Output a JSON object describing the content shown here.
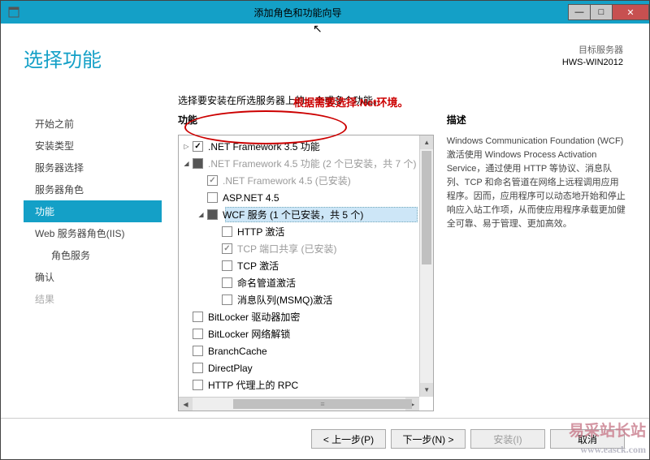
{
  "titlebar": {
    "title": "添加角色和功能向导"
  },
  "page_title": "选择功能",
  "server_info": {
    "label": "目标服务器",
    "name": "HWS-WIN2012"
  },
  "instruction": "选择要安装在所选服务器上的一个或多个功能。",
  "sidebar": {
    "items": [
      {
        "label": "开始之前"
      },
      {
        "label": "安装类型"
      },
      {
        "label": "服务器选择"
      },
      {
        "label": "服务器角色"
      },
      {
        "label": "功能"
      },
      {
        "label": "Web 服务器角色(IIS)"
      },
      {
        "label": "角色服务"
      },
      {
        "label": "确认"
      },
      {
        "label": "结果"
      }
    ]
  },
  "columns": {
    "func": "功能",
    "desc": "描述"
  },
  "annotation": "根据需要选择.Net环境。",
  "tree": {
    "items": [
      {
        "lv": 0,
        "exp": "▷",
        "chk": "checked",
        "label": ".NET Framework 3.5 功能"
      },
      {
        "lv": 0,
        "exp": "◢",
        "chk": "partial",
        "label": ".NET Framework 4.5 功能 (2 个已安装，共 7 个)",
        "dis": true
      },
      {
        "lv": 1,
        "exp": "",
        "chk": "checked dis",
        "label": ".NET Framework 4.5 (已安装)",
        "dis": true
      },
      {
        "lv": 1,
        "exp": "",
        "chk": "",
        "label": "ASP.NET 4.5"
      },
      {
        "lv": 1,
        "exp": "◢",
        "chk": "partial",
        "label": "WCF 服务 (1 个已安装，共 5 个)",
        "sel": true
      },
      {
        "lv": 2,
        "exp": "",
        "chk": "",
        "label": "HTTP 激活"
      },
      {
        "lv": 2,
        "exp": "",
        "chk": "checked dis",
        "label": "TCP 端口共享 (已安装)",
        "dis": true
      },
      {
        "lv": 2,
        "exp": "",
        "chk": "",
        "label": "TCP 激活"
      },
      {
        "lv": 2,
        "exp": "",
        "chk": "",
        "label": "命名管道激活"
      },
      {
        "lv": 2,
        "exp": "",
        "chk": "",
        "label": "消息队列(MSMQ)激活"
      },
      {
        "lv": 0,
        "exp": "",
        "chk": "",
        "label": "BitLocker 驱动器加密"
      },
      {
        "lv": 0,
        "exp": "",
        "chk": "",
        "label": "BitLocker 网络解锁"
      },
      {
        "lv": 0,
        "exp": "",
        "chk": "",
        "label": "BranchCache"
      },
      {
        "lv": 0,
        "exp": "",
        "chk": "",
        "label": "DirectPlay"
      },
      {
        "lv": 0,
        "exp": "",
        "chk": "",
        "label": "HTTP 代理上的 RPC"
      }
    ]
  },
  "description": "Windows Communication Foundation (WCF) 激活使用 Windows Process Activation Service，通过使用 HTTP 等协议、消息队列、TCP 和命名管道在网络上远程调用应用程序。因而，应用程序可以动态地开始和停止响应入站工作项，从而使应用程序承载更加健全可靠、易于管理、更加高效。",
  "footer": {
    "prev": "< 上一步(P)",
    "next": "下一步(N) >",
    "install": "安装(I)",
    "cancel": "取消"
  },
  "watermark": {
    "name": "易采站长站",
    "url": "www.easck.com"
  }
}
